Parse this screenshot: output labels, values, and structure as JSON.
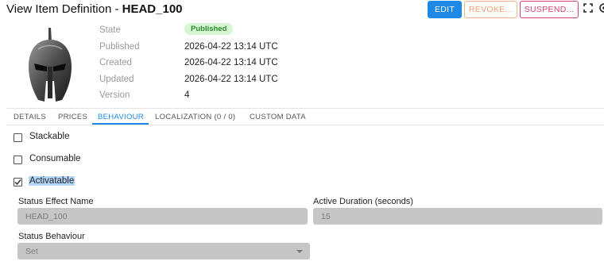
{
  "header": {
    "title": "View Item Definition",
    "item_code": "HEAD_100",
    "buttons": {
      "edit": "EDIT",
      "revoke": "REVOKE...",
      "suspend": "SUSPEND..."
    }
  },
  "item_image": {
    "icon": "spartan-helmet-icon"
  },
  "info": {
    "state_label": "State",
    "state_value": "Published",
    "published_label": "Published",
    "published_value": "2026-04-22 13:14 UTC",
    "created_label": "Created",
    "created_value": "2026-04-22 13:14 UTC",
    "updated_label": "Updated",
    "updated_value": "2026-04-22 13:14 UTC",
    "version_label": "Version",
    "version_value": "4"
  },
  "tabs": [
    {
      "label": "DETAILS"
    },
    {
      "label": "PRICES"
    },
    {
      "label": "BEHAVIOUR",
      "active": true
    },
    {
      "label": "LOCALIZATION (0 / 0)"
    },
    {
      "label": "CUSTOM DATA"
    }
  ],
  "behaviour": {
    "stackable": {
      "label": "Stackable",
      "checked": false
    },
    "consumable": {
      "label": "Consumable",
      "checked": false
    },
    "activatable": {
      "label": "Activatable",
      "checked": true
    },
    "status_effect_name": {
      "label": "Status Effect Name",
      "value": "HEAD_100"
    },
    "active_duration": {
      "label": "Active Duration (seconds)",
      "value": "15"
    },
    "status_behaviour": {
      "label": "Status Behaviour",
      "value": "Set"
    }
  },
  "colors": {
    "primary": "#1e88e5",
    "revoke": "#f0a070",
    "suspend": "#d43f6e",
    "published_bg": "#d6f5d3",
    "published_text": "#2e8b2e",
    "disabled_field": "#c6c6c6"
  }
}
